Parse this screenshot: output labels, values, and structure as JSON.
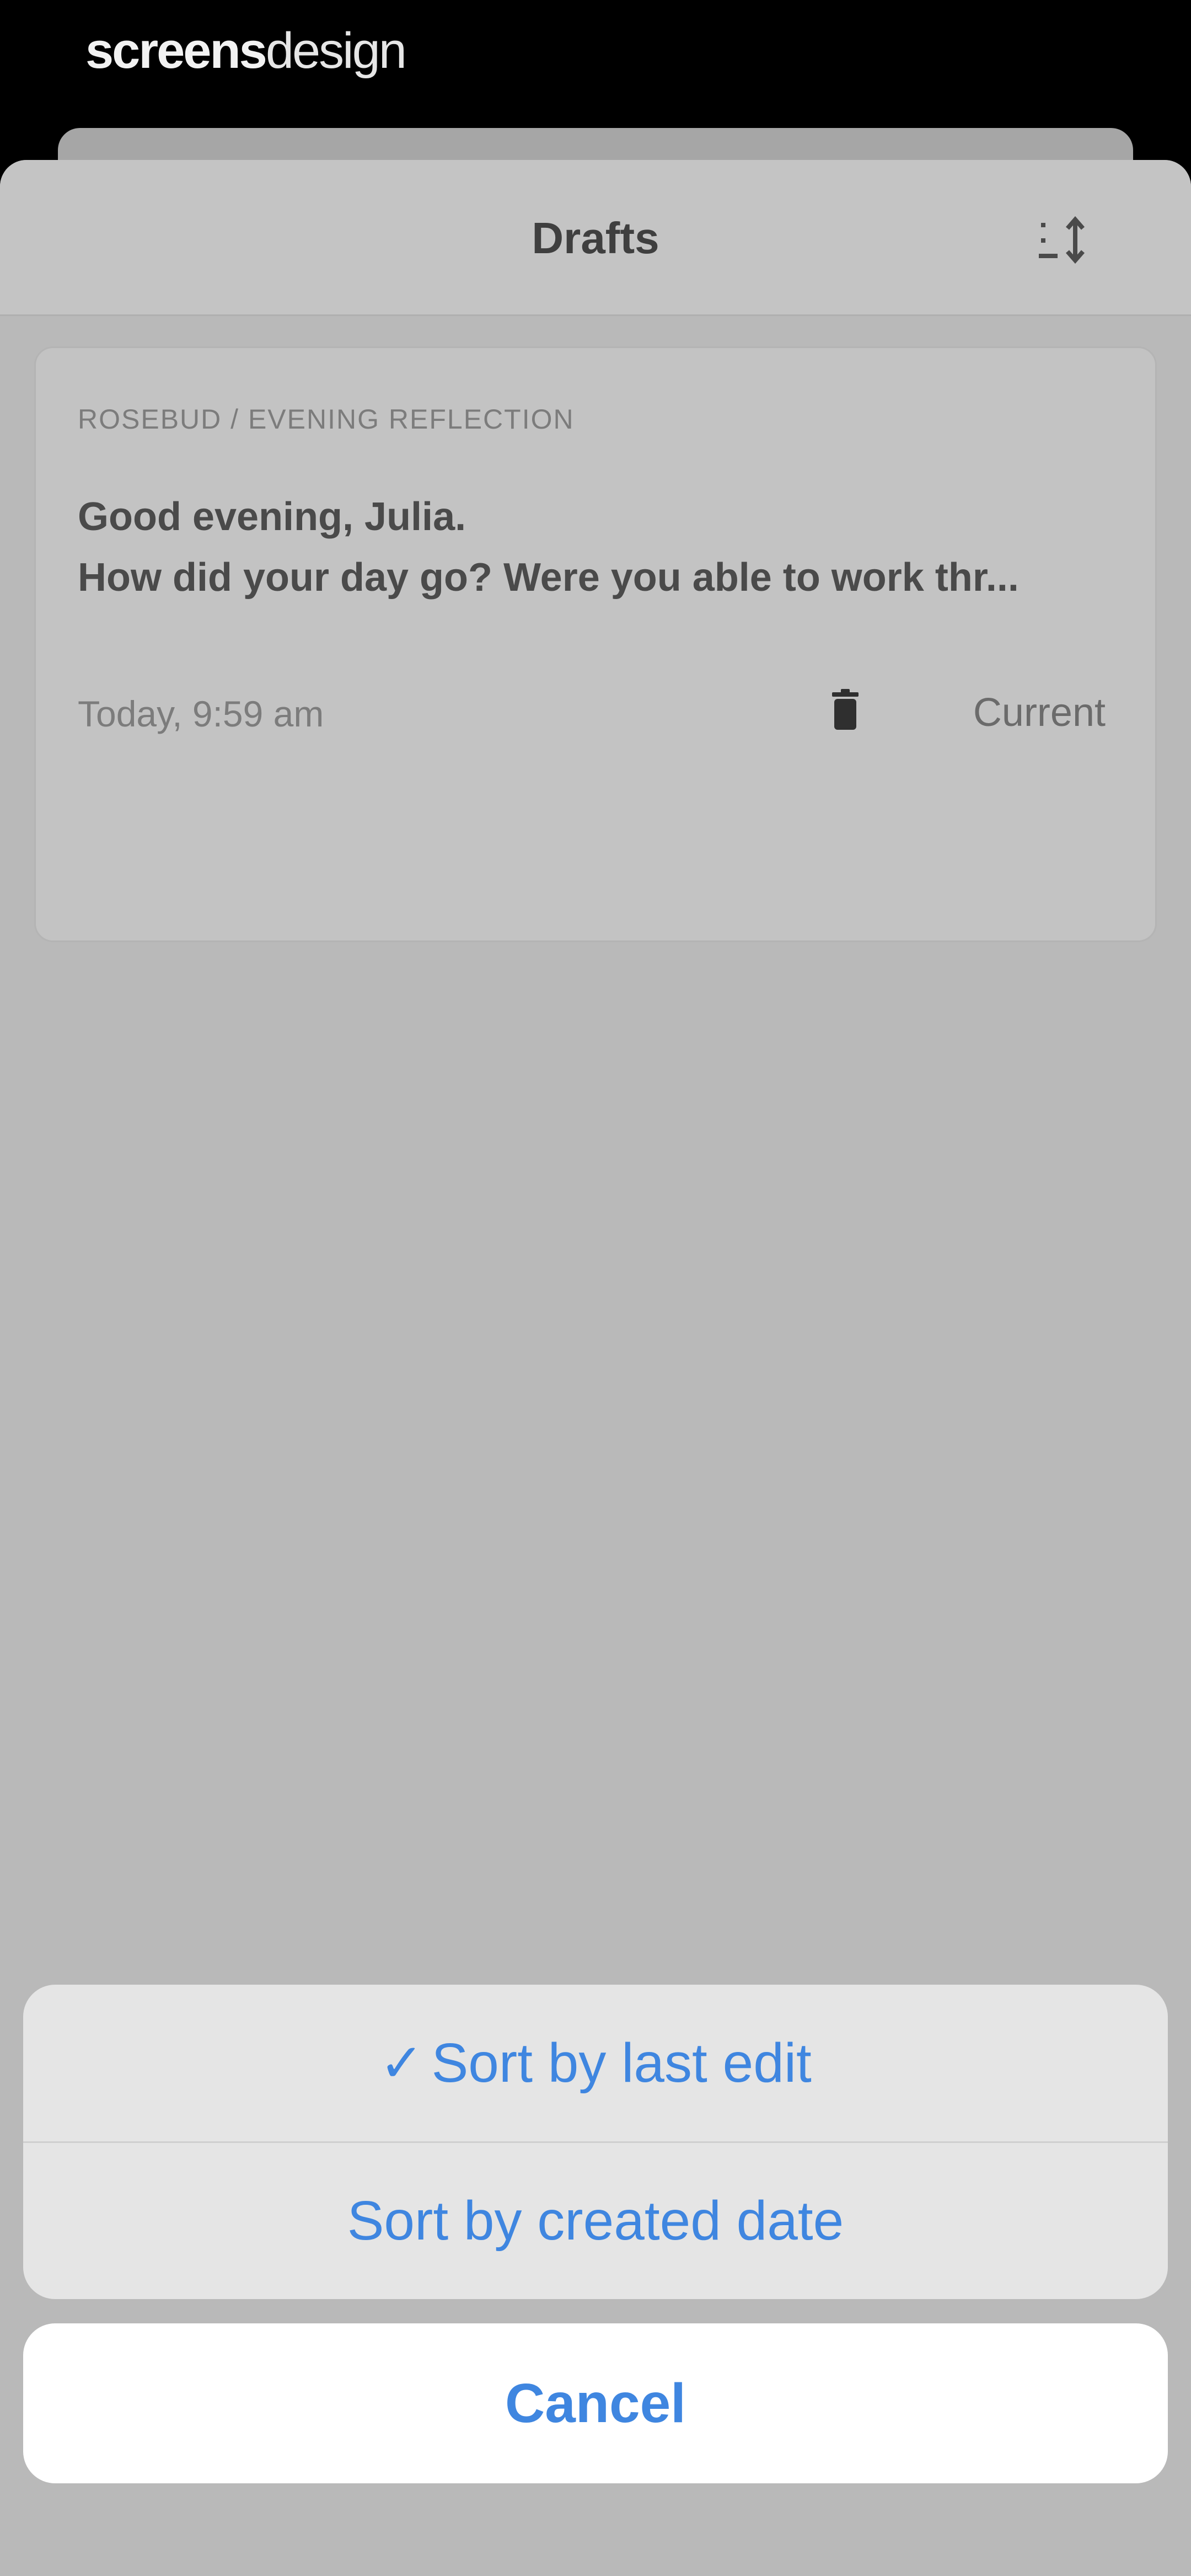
{
  "brand": {
    "part1": "screens",
    "part2": "design"
  },
  "header": {
    "title": "Drafts",
    "sort_icon": "sort-icon"
  },
  "draft": {
    "path": "ROSEBUD / EVENING REFLECTION",
    "line1": "Good evening, Julia.",
    "line2": "How did your day go? Were you able to work thr...",
    "timestamp": "Today, 9:59 am",
    "delete_icon": "trash-icon",
    "status": "Current"
  },
  "action_sheet": {
    "options": [
      {
        "label": "Sort by last edit",
        "checked": true
      },
      {
        "label": "Sort by created date",
        "checked": false
      }
    ],
    "check_glyph": "✓",
    "cancel_label": "Cancel"
  },
  "colors": {
    "accent": "#3f86e0",
    "overlay": "#b9b9b9"
  }
}
